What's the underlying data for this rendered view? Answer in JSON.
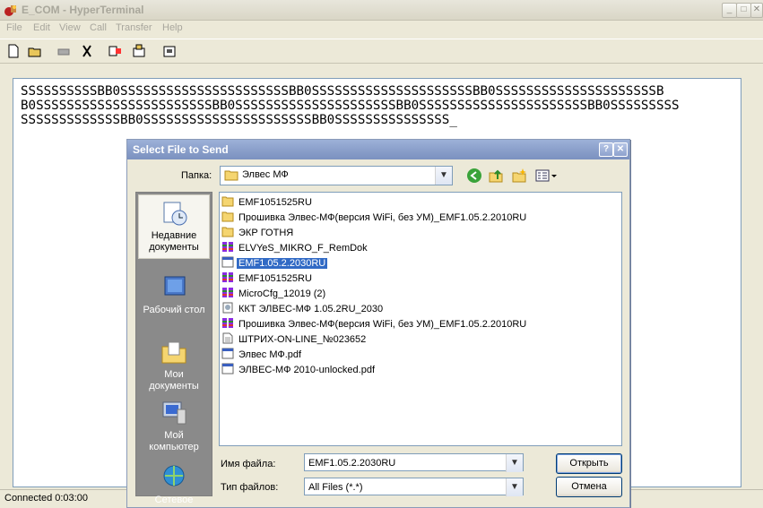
{
  "window": {
    "title": "E_COM - HyperTerminal"
  },
  "menu": [
    "File",
    "Edit",
    "View",
    "Call",
    "Transfer",
    "Help"
  ],
  "terminal": {
    "lines": [
      "SSSSSSSSSSBB0SSSSSSSSSSSSSSSSSSSSSSBB0SSSSSSSSSSSSSSSSSSSSSBB0SSSSSSSSSSSSSSSSSSSSSB",
      "B0SSSSSSSSSSSSSSSSSSSSSSSBB0SSSSSSSSSSSSSSSSSSSSSBB0SSSSSSSSSSSSSSSSSSSSSSBB0SSSSSSSSS",
      "SSSSSSSSSSSSSBB0SSSSSSSSSSSSSSSSSSSSSSBB0SSSSSSSSSSSSSSS_"
    ]
  },
  "status": {
    "connection": "Connected 0:03:00"
  },
  "dialog": {
    "title": "Select File to Send",
    "look_in_label": "Папка:",
    "look_in_value": "Элвес МФ",
    "places": [
      {
        "label": "Недавние документы",
        "icon": "recent-documents-icon"
      },
      {
        "label": "Рабочий стол",
        "icon": "desktop-icon"
      },
      {
        "label": "Мои документы",
        "icon": "my-documents-icon"
      },
      {
        "label": "Мой компьютер",
        "icon": "my-computer-icon"
      },
      {
        "label": "Сетевое",
        "icon": "network-icon"
      }
    ],
    "files": [
      {
        "name": "EMF1051525RU",
        "type": "folder"
      },
      {
        "name": "Прошивка Элвес-МФ(версия WiFi, без УМ)_EMF1.05.2.2010RU",
        "type": "folder"
      },
      {
        "name": "ЭКР ГОТНЯ",
        "type": "folder"
      },
      {
        "name": "ELVYeS_MIKRO_F_RemDok",
        "type": "archive"
      },
      {
        "name": "EMF1.05.2.2030RU",
        "type": "exe",
        "selected": true
      },
      {
        "name": "EMF1051525RU",
        "type": "archive"
      },
      {
        "name": "MicroCfg_12019 (2)",
        "type": "archive"
      },
      {
        "name": "ККТ ЭЛВЕС-МФ 1.05.2RU_2030",
        "type": "setup"
      },
      {
        "name": "Прошивка Элвес-МФ(версия WiFi, без УМ)_EMF1.05.2.2010RU",
        "type": "archive"
      },
      {
        "name": "ШТРИХ-ON-LINE_№023652",
        "type": "doc"
      },
      {
        "name": "Элвес МФ.pdf",
        "type": "exe"
      },
      {
        "name": "ЭЛВЕС-МФ 2010-unlocked.pdf",
        "type": "exe"
      }
    ],
    "file_name_label": "Имя файла:",
    "file_name_value": "EMF1.05.2.2030RU",
    "file_type_label": "Тип файлов:",
    "file_type_value": "All Files (*.*)",
    "open_label": "Открыть",
    "cancel_label": "Отмена"
  },
  "colors": {
    "selection": "#316ac5",
    "dialog_title": "#8ba0cb"
  }
}
